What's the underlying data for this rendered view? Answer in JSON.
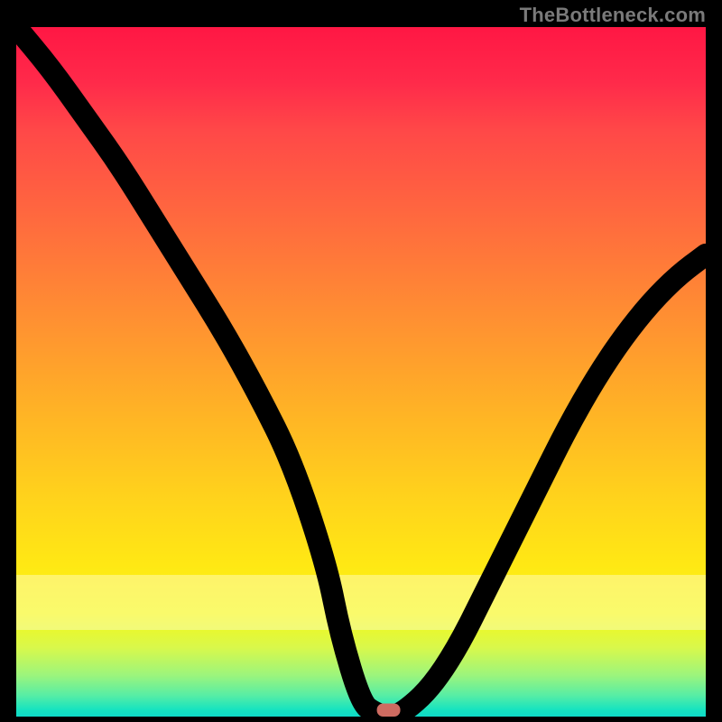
{
  "watermark": {
    "text": "TheBottleneck.com"
  },
  "chart_data": {
    "type": "line",
    "title": "",
    "xlabel": "",
    "ylabel": "",
    "xlim": [
      0,
      100
    ],
    "ylim": [
      0,
      100
    ],
    "grid": false,
    "legend": false,
    "series": [
      {
        "name": "bottleneck-curve",
        "x": [
          0,
          5,
          10,
          15,
          20,
          25,
          30,
          35,
          40,
          45,
          47,
          50,
          52,
          54,
          56,
          60,
          64,
          68,
          72,
          76,
          80,
          84,
          88,
          92,
          96,
          100
        ],
        "y": [
          100,
          94,
          87,
          80,
          72,
          64,
          56,
          47,
          37,
          22,
          12,
          2,
          0.5,
          0,
          0.5,
          4,
          10,
          18,
          26,
          34,
          42,
          49,
          55,
          60,
          64,
          67
        ]
      }
    ],
    "marker": {
      "x": 54,
      "y": 0,
      "shape": "rounded-rect",
      "color": "#ce6b61"
    },
    "background_gradient": {
      "type": "linear-vertical",
      "stops": [
        {
          "pos": 0.0,
          "color": "#ff1744"
        },
        {
          "pos": 0.28,
          "color": "#ff6a3e"
        },
        {
          "pos": 0.55,
          "color": "#ffb126"
        },
        {
          "pos": 0.78,
          "color": "#ffe814"
        },
        {
          "pos": 0.9,
          "color": "#d9f84b"
        },
        {
          "pos": 0.97,
          "color": "#55eda6"
        },
        {
          "pos": 1.0,
          "color": "#0fd9c8"
        }
      ]
    }
  }
}
